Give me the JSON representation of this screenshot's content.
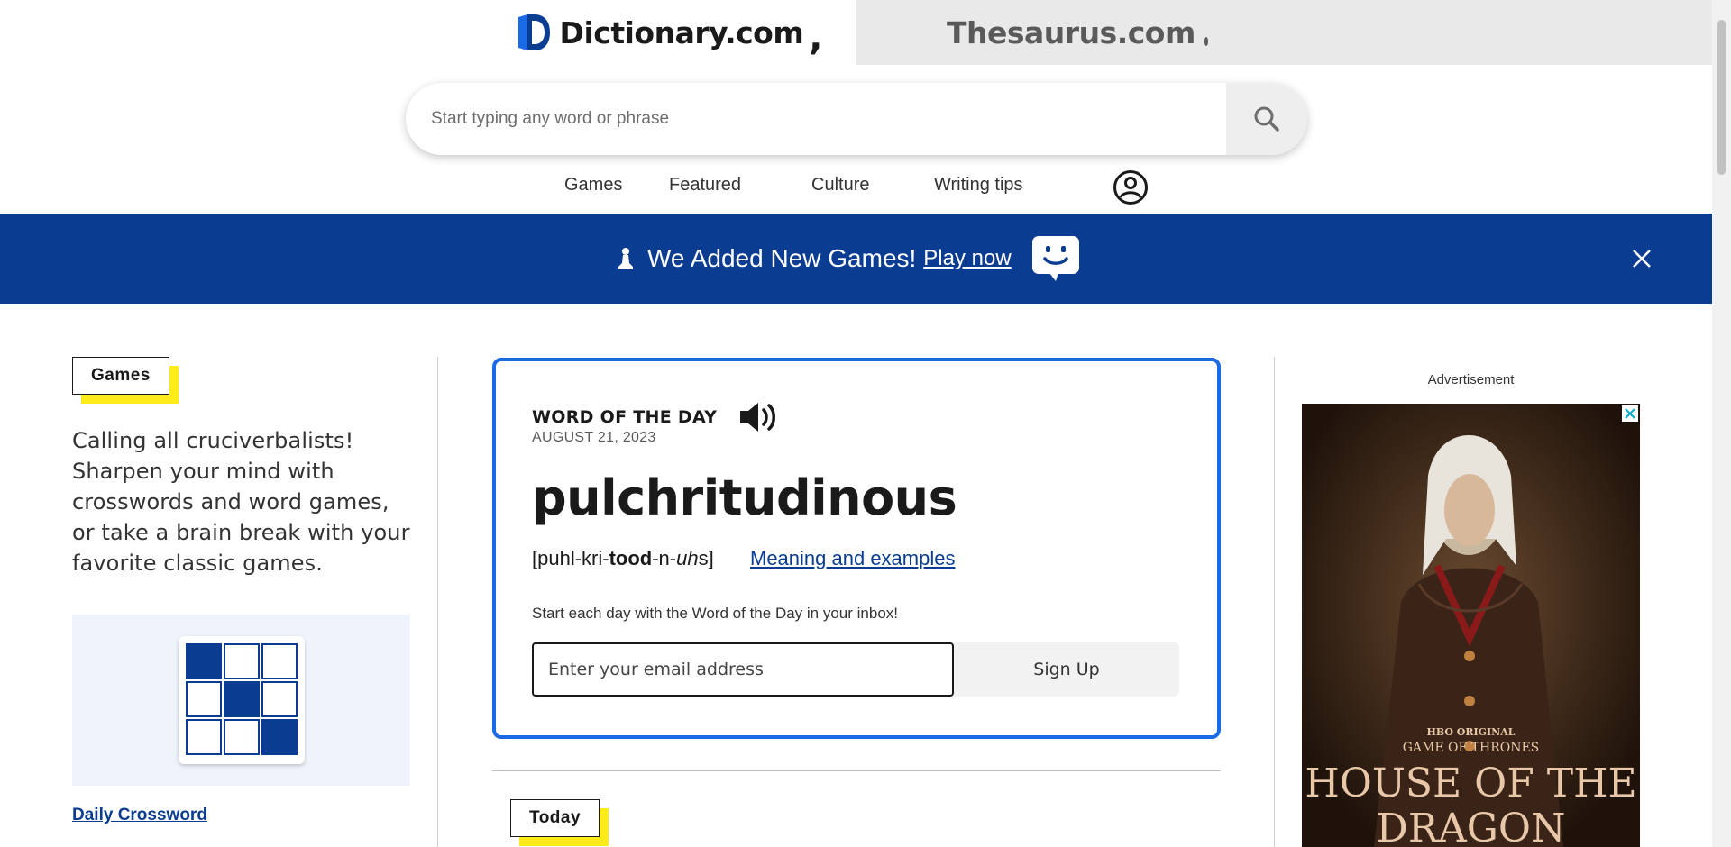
{
  "site_tabs": {
    "dictionary": "Dictionary.com",
    "thesaurus": "Thesaurus.com"
  },
  "search": {
    "placeholder": "Start typing any word or phrase",
    "icon": "search-icon"
  },
  "nav": {
    "items": [
      "Games",
      "Featured",
      "Culture",
      "Writing tips"
    ],
    "account_icon": "account-icon"
  },
  "banner": {
    "text": "We Added New Games!",
    "link": "Play now",
    "background": "#0a3d91"
  },
  "games": {
    "label": "Games",
    "description": "Calling all cruciverbalists! Sharpen your mind with crosswords and word games, or take a brain break with your favorite classic games.",
    "link": "Daily Crossword"
  },
  "wotd": {
    "title": "WORD OF THE DAY",
    "date": "AUGUST 21, 2023",
    "word": "pulchritudinous",
    "pron_open": "[puhl-kri-",
    "pron_bold": "tood",
    "pron_mid": "-n-",
    "pron_italic": "uh",
    "pron_end": "s]",
    "meaning_link": "Meaning and examples",
    "inbox_text": "Start each day with the Word of the Day in your inbox!",
    "email_placeholder": "Enter your email address",
    "signup_label": "Sign Up",
    "accent": "#1a6ae6"
  },
  "today": {
    "label": "Today"
  },
  "ad": {
    "label": "Advertisement",
    "brand_line1": "HBO ORIGINAL",
    "brand_line2": "GAME OF THRONES",
    "brand_line3": "HOUSE OF THE",
    "brand_line4": "DRAGON"
  },
  "colors": {
    "brand_blue": "#0a3d91",
    "highlight_yellow": "#ffeb1a",
    "link_blue": "#0a3d91"
  }
}
